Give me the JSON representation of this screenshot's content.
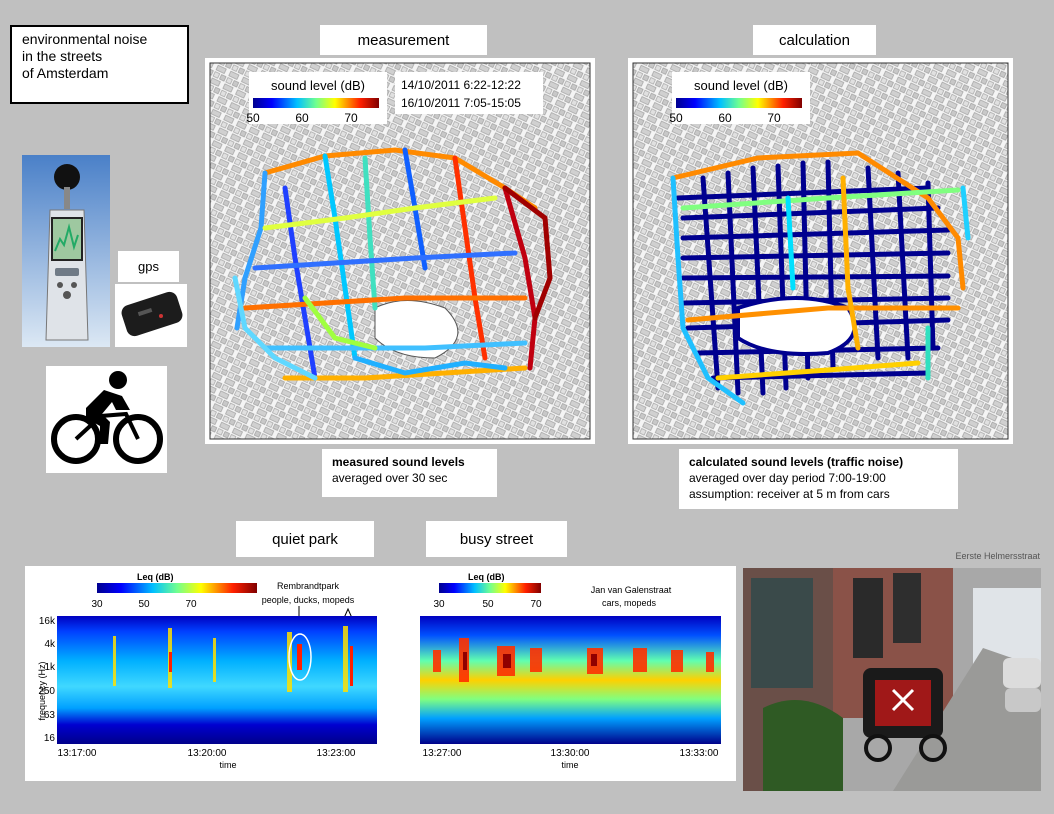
{
  "title": {
    "lines": [
      "environmental noise",
      "in the streets",
      "of Amsterdam"
    ]
  },
  "equipment": {
    "gps_label": "gps"
  },
  "measurement": {
    "header": "measurement",
    "colorbar_title": "sound level (dB)",
    "ticks": [
      "50",
      "60",
      "70"
    ],
    "dates": [
      "14/10/2011 6:22-12:22",
      "16/10/2011 7:05-15:05"
    ],
    "caption_bold": "measured  sound levels",
    "caption_line2": "averaged over 30 sec"
  },
  "calculation": {
    "header": "calculation",
    "colorbar_title": "sound level (dB)",
    "ticks": [
      "50",
      "60",
      "70"
    ],
    "caption_bold": "calculated  sound levels (traffic  noise)",
    "caption_line2": "averaged over day period 7:00-19:00",
    "caption_line3": "assumption: receiver at 5 m from cars"
  },
  "quiet_park": {
    "header": "quiet park",
    "colorbar_title": "Leq (dB)",
    "ticks": [
      "30",
      "50",
      "70"
    ],
    "annotation_line1": "Rembrandtpark",
    "annotation_line2": "people, ducks, mopeds",
    "y_ticks": [
      "16k",
      "4k",
      "1k",
      "250",
      "63",
      "16"
    ],
    "y_label": "frequency (Hz)",
    "x_ticks": [
      "13:17:00",
      "13:20:00",
      "13:23:00"
    ],
    "x_label": "time"
  },
  "busy_street": {
    "header": "busy street",
    "colorbar_title": "Leq (dB)",
    "ticks": [
      "30",
      "50",
      "70"
    ],
    "annotation_line1": "Jan van Galenstraat",
    "annotation_line2": "cars, mopeds",
    "x_ticks": [
      "13:27:00",
      "13:30:00",
      "13:33:00"
    ],
    "x_label": "time"
  },
  "photo": {
    "caption": "Eerste Helmersstraat"
  },
  "colors": {
    "background": "#c0c0c0",
    "jet_low": "#00008f",
    "jet_high": "#800000"
  }
}
